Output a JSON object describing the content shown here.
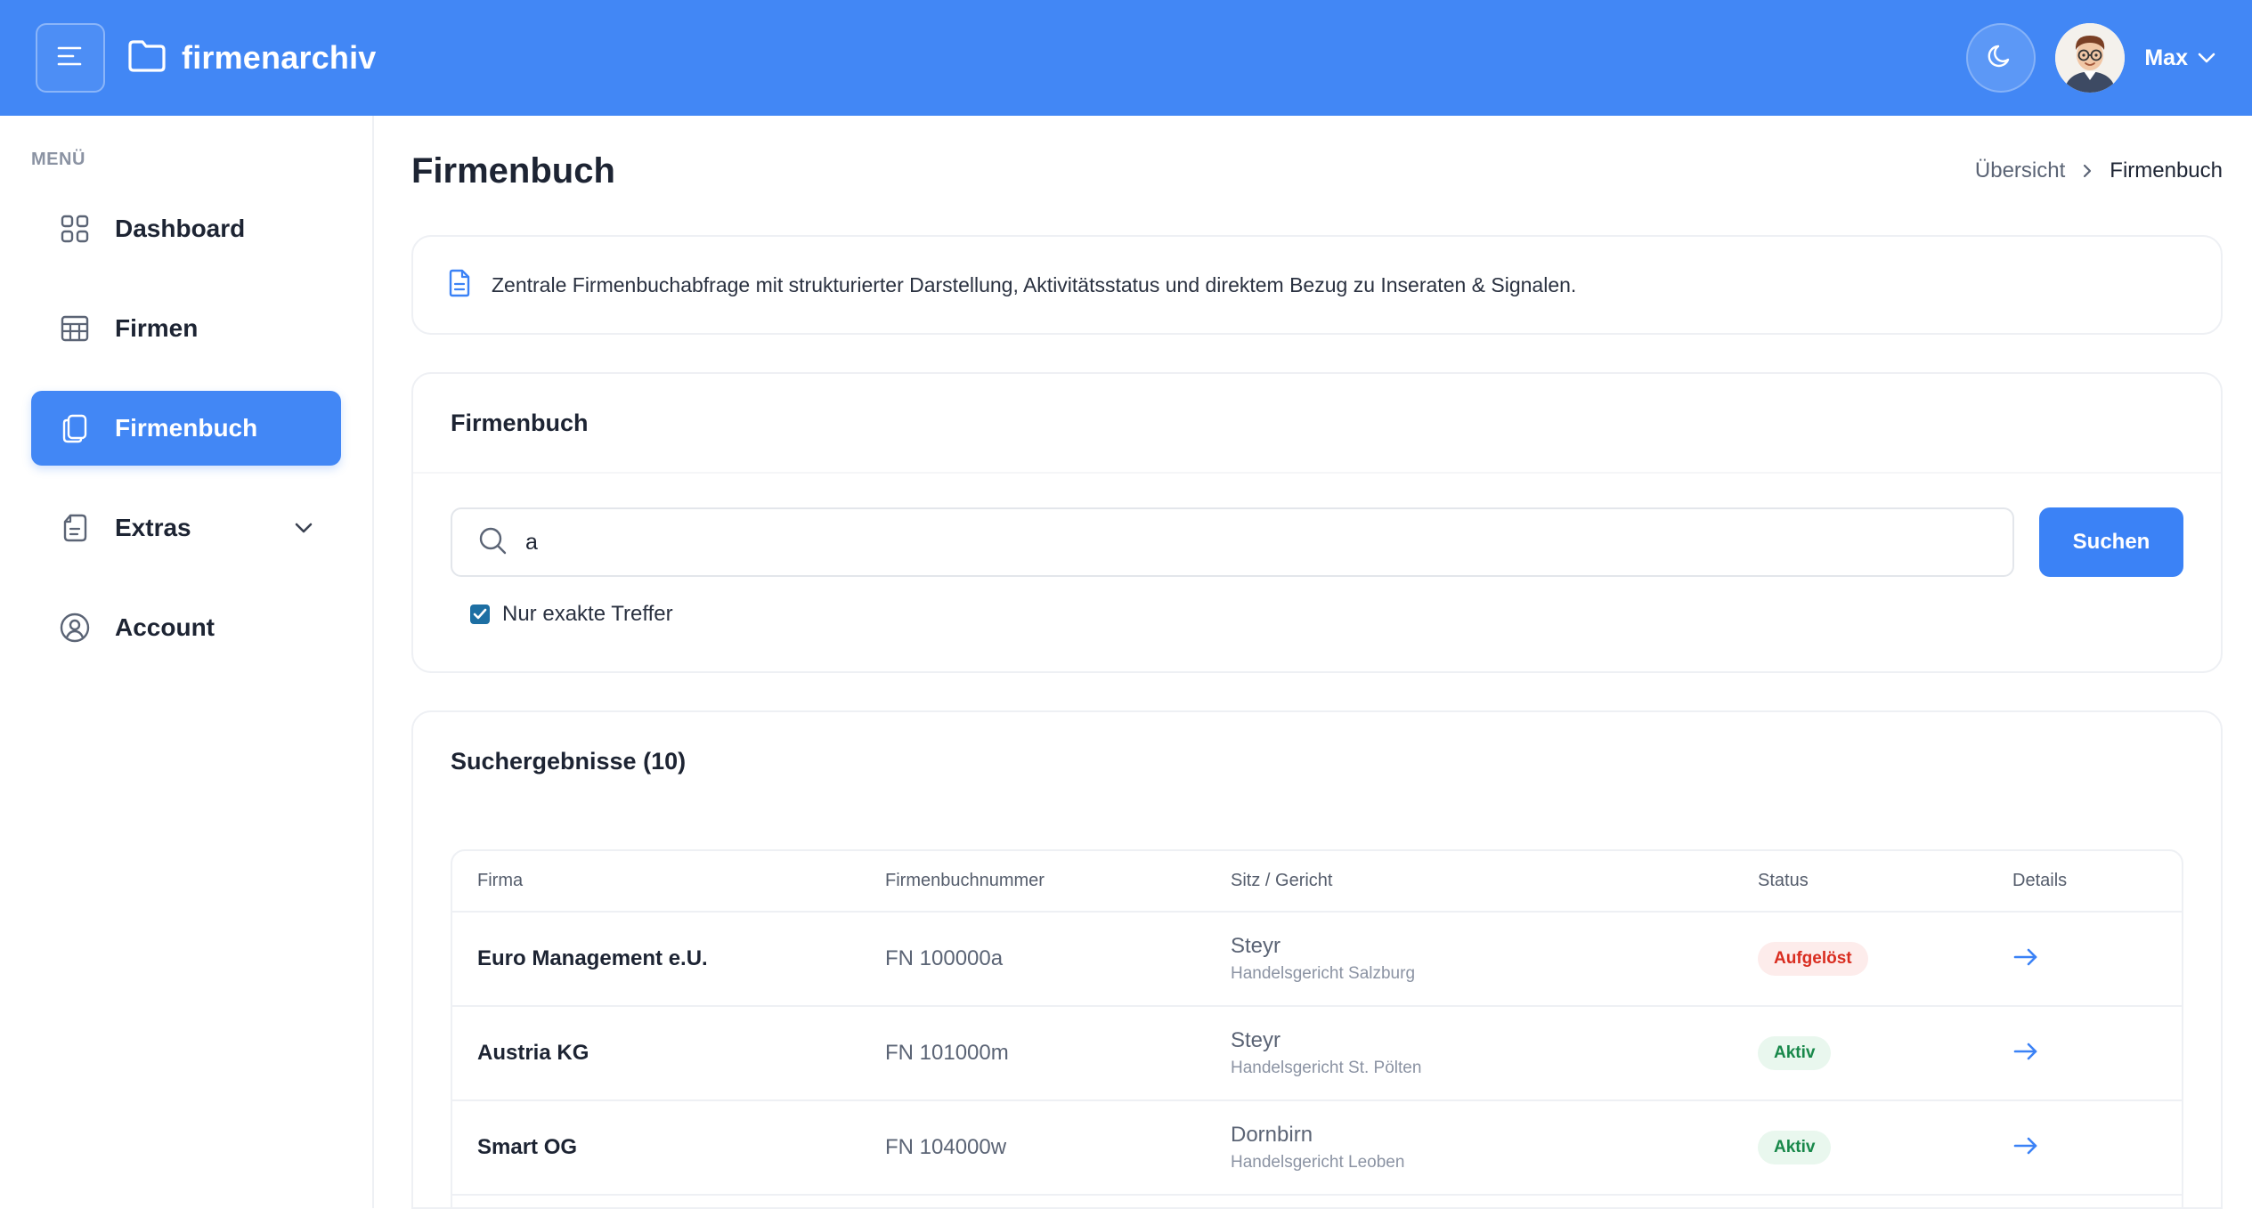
{
  "app": {
    "name": "firmenarchiv",
    "accent": "#4287f5"
  },
  "header": {
    "menu_icon": "menu-lines-icon",
    "logo_icon": "folder-icon",
    "theme_icon": "moon-icon",
    "user_name": "Max"
  },
  "sidebar": {
    "caption": "MENÜ",
    "items": [
      {
        "label": "Dashboard",
        "icon": "grid-icon"
      },
      {
        "label": "Firmen",
        "icon": "table-icon"
      },
      {
        "label": "Firmenbuch",
        "icon": "copy-icon",
        "active": true
      },
      {
        "label": "Extras",
        "icon": "document-icon"
      },
      {
        "label": "Account",
        "icon": "user-circle-icon"
      }
    ]
  },
  "page": {
    "title": "Firmenbuch",
    "breadcrumb": {
      "parent": "Übersicht",
      "current": "Firmenbuch"
    }
  },
  "info": {
    "text": "Zentrale Firmenbuchabfrage mit strukturierter Darstellung, Aktivitätsstatus und direktem Bezug zu Inseraten & Signalen."
  },
  "search": {
    "title": "Firmenbuch",
    "value": "a",
    "button": "Suchen",
    "exact_label": "Nur exakte Treffer",
    "exact_checked": true
  },
  "results": {
    "title": "Suchergebnisse (10)",
    "columns": [
      "Firma",
      "Firmenbuchnummer",
      "Sitz / Gericht",
      "Status",
      "Details"
    ],
    "rows": [
      {
        "firma": "Euro Management e.U.",
        "fn": "FN 100000a",
        "sitz": "Steyr",
        "gericht": "Handelsgericht Salzburg",
        "status": "Aufgelöst",
        "status_color": "#d92d20"
      },
      {
        "firma": "Austria KG",
        "fn": "FN 101000m",
        "sitz": "Steyr",
        "gericht": "Handelsgericht St. Pölten",
        "status": "Aktiv",
        "status_color": "#18884a"
      },
      {
        "firma": "Smart OG",
        "fn": "FN 104000w",
        "sitz": "Dornbirn",
        "gericht": "Handelsgericht Leoben",
        "status": "Aktiv",
        "status_color": "#18884a"
      }
    ]
  }
}
